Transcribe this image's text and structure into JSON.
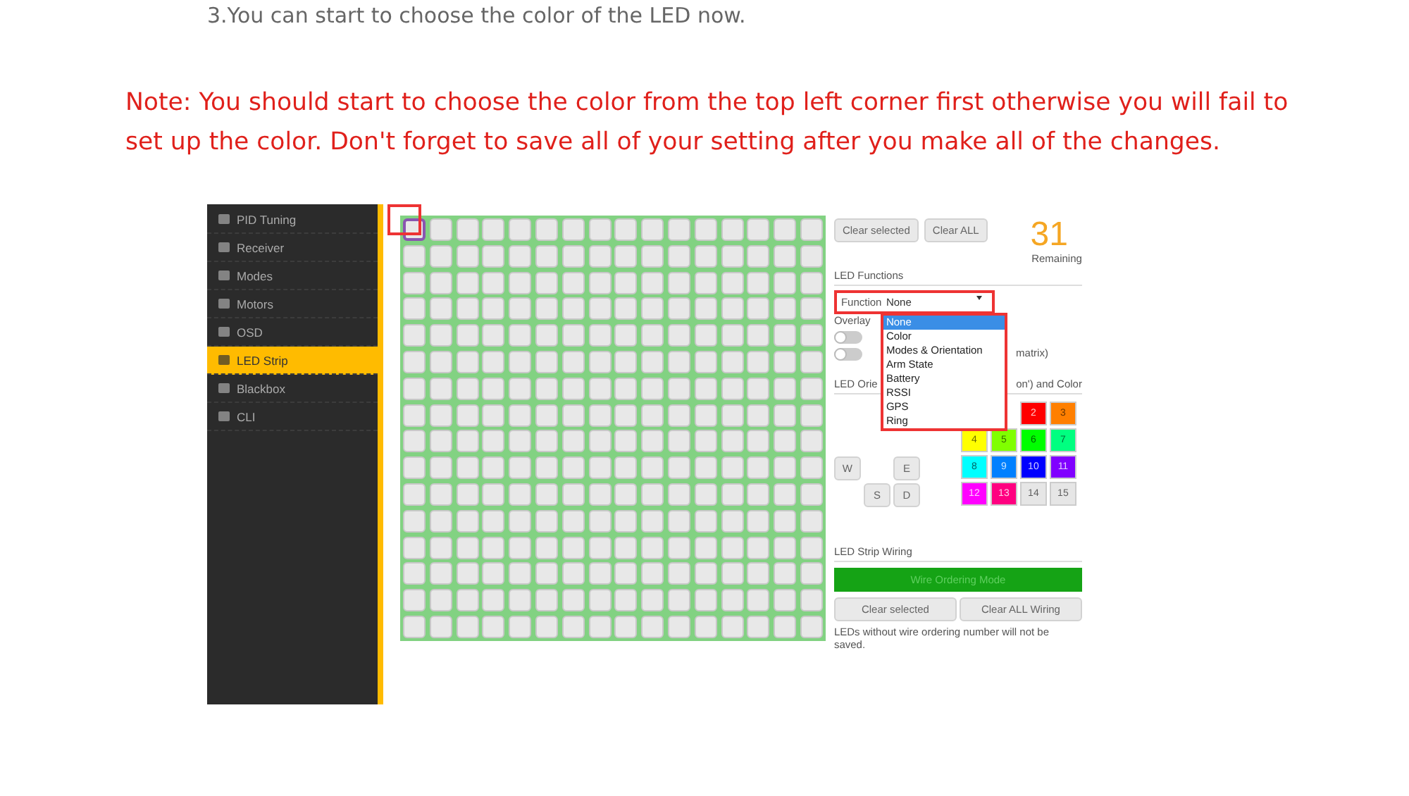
{
  "intro": "3.You can start to choose the color of the LED now.",
  "note": "Note: You should start to choose the color from the top left corner first otherwise you will fail to set up the color. Don't forget to save all of your setting after you make all of the changes.",
  "app": {
    "sidebar": [
      {
        "label": "PID Tuning",
        "selected": false
      },
      {
        "label": "Receiver",
        "selected": false
      },
      {
        "label": "Modes",
        "selected": false
      },
      {
        "label": "Motors",
        "selected": false
      },
      {
        "label": "OSD",
        "selected": false
      },
      {
        "label": "LED Strip",
        "selected": true
      },
      {
        "label": "Blackbox",
        "selected": false
      },
      {
        "label": "CLI",
        "selected": false
      }
    ],
    "matrix": [
      [
        {
          "selected": true
        },
        {
          "selected": false
        },
        {
          "selected": false
        },
        {
          "selected": false
        },
        {
          "selected": false
        },
        {
          "selected": false
        },
        {
          "selected": false
        },
        {
          "selected": false
        },
        {
          "selected": false
        },
        {
          "selected": false
        },
        {
          "selected": false
        },
        {
          "selected": false
        },
        {
          "selected": false
        },
        {
          "selected": false
        },
        {
          "selected": false
        },
        {
          "selected": false
        }
      ],
      [
        {
          "selected": false
        },
        {
          "selected": false
        },
        {
          "selected": false
        },
        {
          "selected": false
        },
        {
          "selected": false
        },
        {
          "selected": false
        },
        {
          "selected": false
        },
        {
          "selected": false
        },
        {
          "selected": false
        },
        {
          "selected": false
        },
        {
          "selected": false
        },
        {
          "selected": false
        },
        {
          "selected": false
        },
        {
          "selected": false
        },
        {
          "selected": false
        },
        {
          "selected": false
        }
      ],
      [
        {
          "selected": false
        },
        {
          "selected": false
        },
        {
          "selected": false
        },
        {
          "selected": false
        },
        {
          "selected": false
        },
        {
          "selected": false
        },
        {
          "selected": false
        },
        {
          "selected": false
        },
        {
          "selected": false
        },
        {
          "selected": false
        },
        {
          "selected": false
        },
        {
          "selected": false
        },
        {
          "selected": false
        },
        {
          "selected": false
        },
        {
          "selected": false
        },
        {
          "selected": false
        }
      ],
      [
        {
          "selected": false
        },
        {
          "selected": false
        },
        {
          "selected": false
        },
        {
          "selected": false
        },
        {
          "selected": false
        },
        {
          "selected": false
        },
        {
          "selected": false
        },
        {
          "selected": false
        },
        {
          "selected": false
        },
        {
          "selected": false
        },
        {
          "selected": false
        },
        {
          "selected": false
        },
        {
          "selected": false
        },
        {
          "selected": false
        },
        {
          "selected": false
        },
        {
          "selected": false
        }
      ],
      [
        {
          "selected": false
        },
        {
          "selected": false
        },
        {
          "selected": false
        },
        {
          "selected": false
        },
        {
          "selected": false
        },
        {
          "selected": false
        },
        {
          "selected": false
        },
        {
          "selected": false
        },
        {
          "selected": false
        },
        {
          "selected": false
        },
        {
          "selected": false
        },
        {
          "selected": false
        },
        {
          "selected": false
        },
        {
          "selected": false
        },
        {
          "selected": false
        },
        {
          "selected": false
        }
      ],
      [
        {
          "selected": false
        },
        {
          "selected": false
        },
        {
          "selected": false
        },
        {
          "selected": false
        },
        {
          "selected": false
        },
        {
          "selected": false
        },
        {
          "selected": false
        },
        {
          "selected": false
        },
        {
          "selected": false
        },
        {
          "selected": false
        },
        {
          "selected": false
        },
        {
          "selected": false
        },
        {
          "selected": false
        },
        {
          "selected": false
        },
        {
          "selected": false
        },
        {
          "selected": false
        }
      ],
      [
        {
          "selected": false
        },
        {
          "selected": false
        },
        {
          "selected": false
        },
        {
          "selected": false
        },
        {
          "selected": false
        },
        {
          "selected": false
        },
        {
          "selected": false
        },
        {
          "selected": false
        },
        {
          "selected": false
        },
        {
          "selected": false
        },
        {
          "selected": false
        },
        {
          "selected": false
        },
        {
          "selected": false
        },
        {
          "selected": false
        },
        {
          "selected": false
        },
        {
          "selected": false
        }
      ],
      [
        {
          "selected": false
        },
        {
          "selected": false
        },
        {
          "selected": false
        },
        {
          "selected": false
        },
        {
          "selected": false
        },
        {
          "selected": false
        },
        {
          "selected": false
        },
        {
          "selected": false
        },
        {
          "selected": false
        },
        {
          "selected": false
        },
        {
          "selected": false
        },
        {
          "selected": false
        },
        {
          "selected": false
        },
        {
          "selected": false
        },
        {
          "selected": false
        },
        {
          "selected": false
        }
      ],
      [
        {
          "selected": false
        },
        {
          "selected": false
        },
        {
          "selected": false
        },
        {
          "selected": false
        },
        {
          "selected": false
        },
        {
          "selected": false
        },
        {
          "selected": false
        },
        {
          "selected": false
        },
        {
          "selected": false
        },
        {
          "selected": false
        },
        {
          "selected": false
        },
        {
          "selected": false
        },
        {
          "selected": false
        },
        {
          "selected": false
        },
        {
          "selected": false
        },
        {
          "selected": false
        }
      ],
      [
        {
          "selected": false
        },
        {
          "selected": false
        },
        {
          "selected": false
        },
        {
          "selected": false
        },
        {
          "selected": false
        },
        {
          "selected": false
        },
        {
          "selected": false
        },
        {
          "selected": false
        },
        {
          "selected": false
        },
        {
          "selected": false
        },
        {
          "selected": false
        },
        {
          "selected": false
        },
        {
          "selected": false
        },
        {
          "selected": false
        },
        {
          "selected": false
        },
        {
          "selected": false
        }
      ],
      [
        {
          "selected": false
        },
        {
          "selected": false
        },
        {
          "selected": false
        },
        {
          "selected": false
        },
        {
          "selected": false
        },
        {
          "selected": false
        },
        {
          "selected": false
        },
        {
          "selected": false
        },
        {
          "selected": false
        },
        {
          "selected": false
        },
        {
          "selected": false
        },
        {
          "selected": false
        },
        {
          "selected": false
        },
        {
          "selected": false
        },
        {
          "selected": false
        },
        {
          "selected": false
        }
      ],
      [
        {
          "selected": false
        },
        {
          "selected": false
        },
        {
          "selected": false
        },
        {
          "selected": false
        },
        {
          "selected": false
        },
        {
          "selected": false
        },
        {
          "selected": false
        },
        {
          "selected": false
        },
        {
          "selected": false
        },
        {
          "selected": false
        },
        {
          "selected": false
        },
        {
          "selected": false
        },
        {
          "selected": false
        },
        {
          "selected": false
        },
        {
          "selected": false
        },
        {
          "selected": false
        }
      ],
      [
        {
          "selected": false
        },
        {
          "selected": false
        },
        {
          "selected": false
        },
        {
          "selected": false
        },
        {
          "selected": false
        },
        {
          "selected": false
        },
        {
          "selected": false
        },
        {
          "selected": false
        },
        {
          "selected": false
        },
        {
          "selected": false
        },
        {
          "selected": false
        },
        {
          "selected": false
        },
        {
          "selected": false
        },
        {
          "selected": false
        },
        {
          "selected": false
        },
        {
          "selected": false
        }
      ],
      [
        {
          "selected": false
        },
        {
          "selected": false
        },
        {
          "selected": false
        },
        {
          "selected": false
        },
        {
          "selected": false
        },
        {
          "selected": false
        },
        {
          "selected": false
        },
        {
          "selected": false
        },
        {
          "selected": false
        },
        {
          "selected": false
        },
        {
          "selected": false
        },
        {
          "selected": false
        },
        {
          "selected": false
        },
        {
          "selected": false
        },
        {
          "selected": false
        },
        {
          "selected": false
        }
      ],
      [
        {
          "selected": false
        },
        {
          "selected": false
        },
        {
          "selected": false
        },
        {
          "selected": false
        },
        {
          "selected": false
        },
        {
          "selected": false
        },
        {
          "selected": false
        },
        {
          "selected": false
        },
        {
          "selected": false
        },
        {
          "selected": false
        },
        {
          "selected": false
        },
        {
          "selected": false
        },
        {
          "selected": false
        },
        {
          "selected": false
        },
        {
          "selected": false
        },
        {
          "selected": false
        }
      ],
      [
        {
          "selected": false
        },
        {
          "selected": false
        },
        {
          "selected": false
        },
        {
          "selected": false
        },
        {
          "selected": false
        },
        {
          "selected": false
        },
        {
          "selected": false
        },
        {
          "selected": false
        },
        {
          "selected": false
        },
        {
          "selected": false
        },
        {
          "selected": false
        },
        {
          "selected": false
        },
        {
          "selected": false
        },
        {
          "selected": false
        },
        {
          "selected": false
        },
        {
          "selected": false
        }
      ]
    ],
    "top_buttons": [
      "Clear selected",
      "Clear ALL"
    ],
    "remaining_count": "31",
    "remaining_label": "Remaining",
    "functions_heading": "LED Functions",
    "function_label": "Function",
    "function_value": "None",
    "function_options": [
      {
        "label": "None",
        "selected": true
      },
      {
        "label": "Color",
        "selected": false
      },
      {
        "label": "Modes & Orientation",
        "selected": false
      },
      {
        "label": "Arm State",
        "selected": false
      },
      {
        "label": "Battery",
        "selected": false
      },
      {
        "label": "RSSI",
        "selected": false
      },
      {
        "label": "GPS",
        "selected": false
      },
      {
        "label": "Ring",
        "selected": false
      }
    ],
    "overlay_label": "Overlay",
    "overlay_toggles": [
      {
        "on": false
      },
      {
        "on": false
      }
    ],
    "overlay_hint": "matrix)",
    "orientation_heading": "LED Orie",
    "color_heading": "on') and Color",
    "directions": [
      "W",
      "E",
      "S",
      "D"
    ],
    "swatches": [
      {
        "label": "2",
        "color": "#ff0000"
      },
      {
        "label": "3",
        "color": "#ff7f00"
      },
      {
        "label": "4",
        "color": "#ffff00"
      },
      {
        "label": "5",
        "color": "#80ff00"
      },
      {
        "label": "6",
        "color": "#00ff00"
      },
      {
        "label": "7",
        "color": "#00ff80"
      },
      {
        "label": "8",
        "color": "#00ffff"
      },
      {
        "label": "9",
        "color": "#0080ff"
      },
      {
        "label": "10",
        "color": "#0000ff"
      },
      {
        "label": "11",
        "color": "#8000ff"
      },
      {
        "label": "12",
        "color": "#ff00ff"
      },
      {
        "label": "13",
        "color": "#ff0080"
      },
      {
        "label": "14",
        "color": "#e6e6e6"
      },
      {
        "label": "15",
        "color": "#e6e6e6"
      }
    ],
    "wiring_heading": "LED Strip Wiring",
    "wire_mode_button": "Wire Ordering Mode",
    "wiring_buttons": [
      "Clear selected",
      "Clear ALL Wiring"
    ],
    "wiring_note": "LEDs without wire ordering number will not be saved."
  }
}
